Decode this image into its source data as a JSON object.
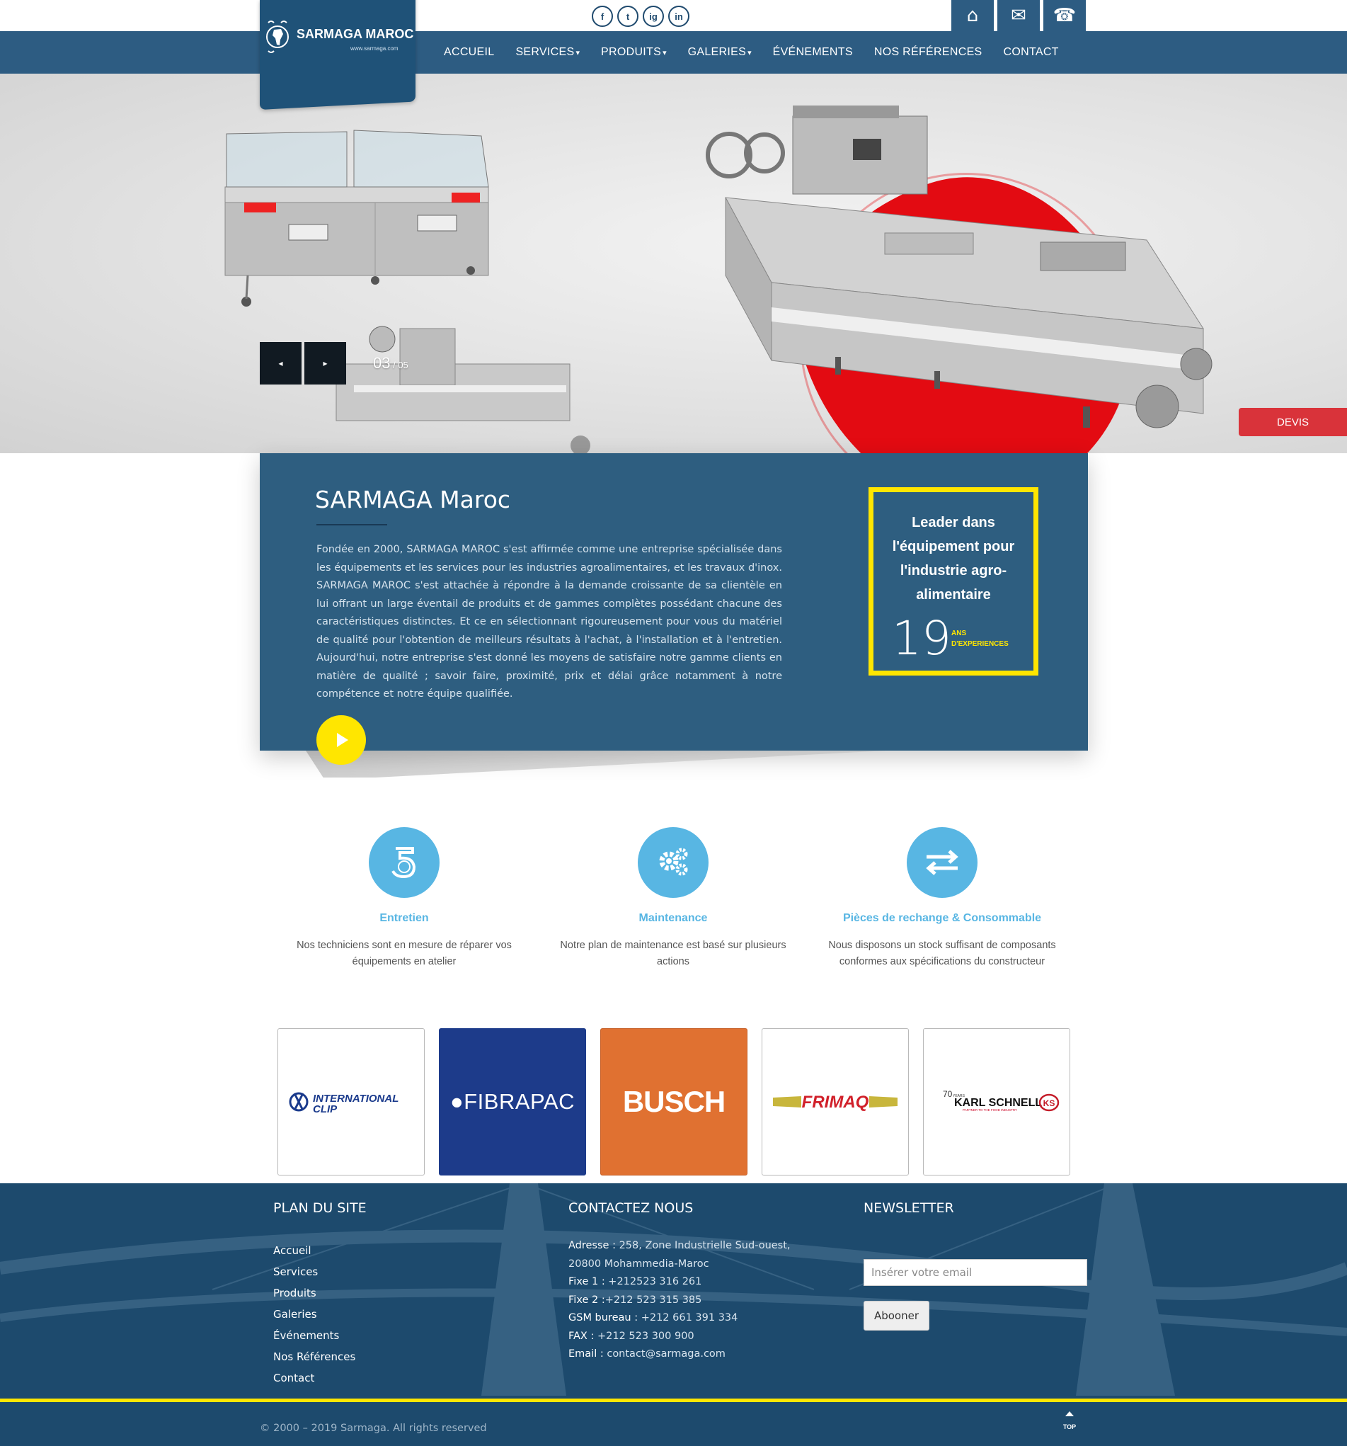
{
  "social": [
    "f",
    "t",
    "ig",
    "in"
  ],
  "quick_links": [
    {
      "icon": "home-icon",
      "glyph": "⌂"
    },
    {
      "icon": "mail-icon",
      "glyph": "✉"
    },
    {
      "icon": "phone-icon",
      "glyph": "☎"
    }
  ],
  "logo": {
    "title": "SARMAGA MAROC",
    "url": "www.sarmaga.com"
  },
  "nav": [
    "ACCUEIL",
    "SERVICES",
    "PRODUITS",
    "GALERIES",
    "ÉVÉNEMENTS",
    "NOS RÉFÉRENCES",
    "CONTACT"
  ],
  "nav_dropdowns": [
    "SERVICES",
    "PRODUITS",
    "GALERIES"
  ],
  "hero": {
    "current": "03",
    "total": "05",
    "devis_label": "DEVIS"
  },
  "about": {
    "title": "SARMAGA Maroc",
    "text": "Fondée en 2000, SARMAGA MAROC s'est affirmée comme une entreprise spécialisée dans les équipements et les services pour les industries agroalimentaires, et les travaux d'inox. SARMAGA MAROC s'est attachée à répondre à la demande croissante de sa clientèle en lui offrant un large éventail de produits et de gammes complètes possédant chacune des caractéristiques distinctes. Et ce en sélectionnant rigoureusement pour vous du matériel de qualité pour l'obtention de meilleurs résultats à l'achat, à l'installation et à l'entretien. Aujourd'hui, notre entreprise s'est donné les moyens de satisfaire notre gamme clients en matière de qualité ; savoir faire, proximité, prix et délai grâce notamment à notre compétence et notre équipe qualifiée.",
    "leader_text": "Leader dans l'équipement pour l'industrie agro-alimentaire",
    "years": "19",
    "years_label_1": "ANS",
    "years_label_2": "D'EXPERIENCES"
  },
  "services": [
    {
      "title": "Entretien",
      "desc": "Nos techniciens sont en mesure de réparer vos équipements en atelier"
    },
    {
      "title": "Maintenance",
      "desc": "Notre plan de maintenance est basé sur plusieurs actions"
    },
    {
      "title": "Pièces de rechange & Consommable",
      "desc": "Nous disposons un stock suffisant de composants conformes aux spécifications du constructeur"
    }
  ],
  "brands": [
    {
      "name": "INTERNATIONAL CLIP",
      "line1": "INTERNATIONAL",
      "line2": "CLIP"
    },
    {
      "name": "FIBRAPAC",
      "label": "FIBRAPAC"
    },
    {
      "name": "BUSCH",
      "label": "BUSCH"
    },
    {
      "name": "FRIMAQ",
      "label": "FRIMAQ"
    },
    {
      "name": "KARL SCHNELL",
      "label": "KARL SCHNELL",
      "years": "70",
      "years_word": "YEARS",
      "tag": "PARTNER TO THE FOOD INDUSTRY",
      "badge": "KS"
    }
  ],
  "footer": {
    "plan_title": "PLAN DU SITE",
    "plan_links": [
      "Accueil",
      "Services",
      "Produits",
      "Galeries",
      "Événements",
      "Nos Références",
      "Contact"
    ],
    "contact_title": "CONTACTEZ NOUS",
    "contact": [
      {
        "label": "Adresse :",
        "value": " 258, Zone Industrielle Sud-ouest,"
      },
      {
        "label": "",
        "value": "20800 Mohammedia-Maroc"
      },
      {
        "label": "Fixe 1 :",
        "value": " +212523 316 261"
      },
      {
        "label": "Fixe 2 :",
        "value": "+212 523 315 385"
      },
      {
        "label": "GSM bureau :",
        "value": " +212 661 391 334"
      },
      {
        "label": "FAX :",
        "value": " +212 523 300 900"
      },
      {
        "label": "Email :",
        "value": " contact@sarmaga.com"
      }
    ],
    "newsletter_title": "NEWSLETTER",
    "newsletter_placeholder": "Insérer votre email",
    "newsletter_button": "Abooner",
    "copyright": "© 2000 – 2019 Sarmaga. All rights reserved",
    "top_label": "TOP"
  },
  "colors": {
    "primary": "#2d5c82",
    "accent": "#ffe600",
    "service_blue": "#58b6e3",
    "devis_red": "#d9333a",
    "hero_red": "#e30b12"
  }
}
